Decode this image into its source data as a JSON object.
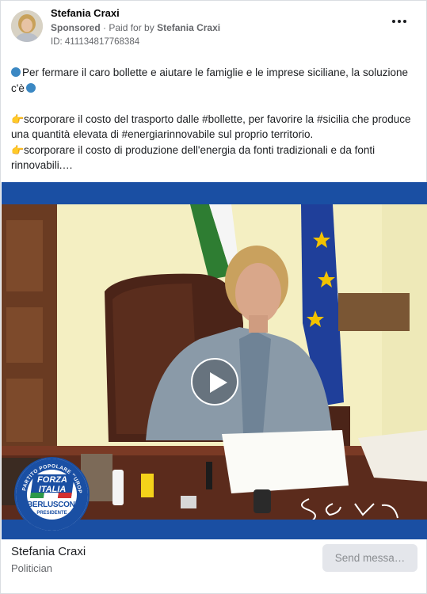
{
  "ad": {
    "page_name": "Stefania Craxi",
    "sponsored_label": "Sponsored",
    "separator": "·",
    "paid_for_prefix": "Paid for by",
    "paid_for_name": "Stefania Craxi",
    "id_text": "ID: 411134817768384",
    "more_icon": "more-options-icon"
  },
  "body": {
    "line1": "Per fermare il caro bollette e aiutare le famiglie e le imprese siciliane, la soluzione c'è",
    "line2": "scorporare il costo del trasporto dalle #bollette, per favorire la #sicilia che produce una quantità elevata di #energiarinnovabile sul proprio territorio.",
    "line3": "scorporare il costo di produzione dell'energia da fonti tradizionali e da fonti rinnovabili.…"
  },
  "media": {
    "play_icon": "play-icon",
    "logo_party": "PARTITO POPOLARE EUROPEO",
    "logo_name": "FORZA ITALIA",
    "logo_leader": "BERLUSCONI",
    "logo_role": "PRESIDENTE"
  },
  "footer": {
    "name": "Stefania Craxi",
    "category": "Politician",
    "cta_label": "Send messa…"
  },
  "colors": {
    "brand_blue": "#1a4fa3",
    "emoji_blue": "#3b88c3",
    "text": "#1c1e21",
    "muted": "#65676b"
  }
}
